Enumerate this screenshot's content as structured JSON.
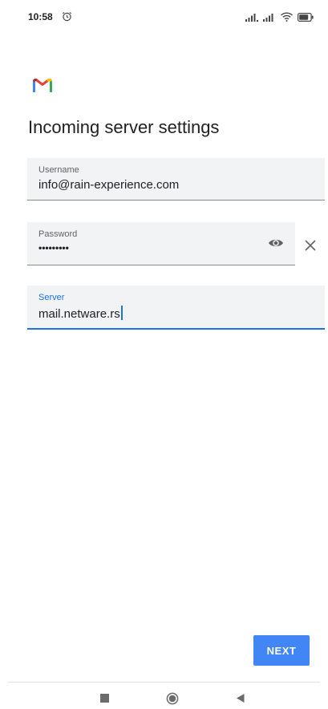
{
  "status_bar": {
    "time": "10:58",
    "alarm_icon": "alarm-icon",
    "signal_icons": [
      "signal-icon",
      "signal-icon"
    ],
    "wifi_icon": "wifi-icon",
    "battery_icon": "battery-icon"
  },
  "app": {
    "logo_icon": "gmail-logo-icon",
    "title": "Incoming server settings"
  },
  "form": {
    "username": {
      "label": "Username",
      "value": "info@rain-experience.com"
    },
    "password": {
      "label": "Password",
      "value": "•••••••••",
      "toggle_icon": "eye-icon",
      "clear_icon": "close-icon"
    },
    "server": {
      "label": "Server",
      "value": "mail.netware.rs",
      "focused": true
    }
  },
  "actions": {
    "next_label": "NEXT"
  },
  "nav_bar": {
    "recents_icon": "square-icon",
    "home_icon": "circle-icon",
    "back_icon": "triangle-back-icon"
  },
  "colors": {
    "accent": "#1a73e8",
    "button": "#4285f4",
    "field_bg": "#f1f3f4"
  }
}
